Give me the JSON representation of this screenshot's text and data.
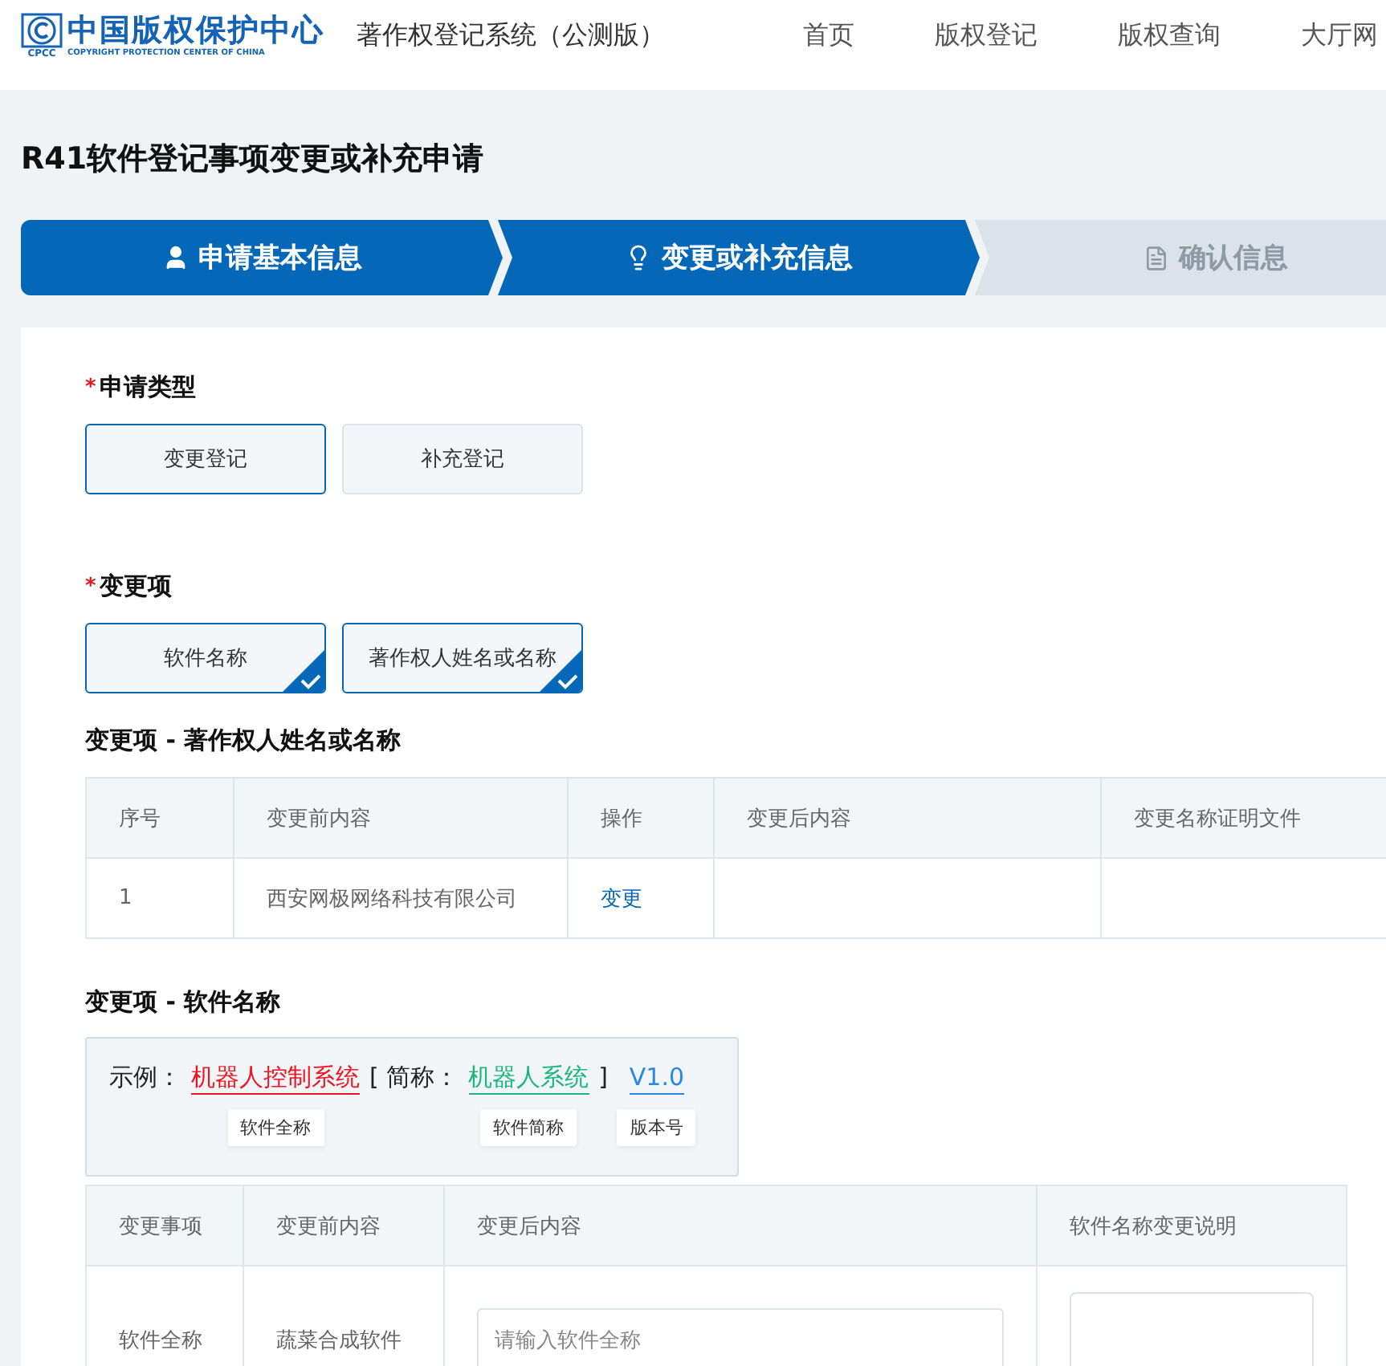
{
  "header": {
    "logo": {
      "name": "中国版权保护中心",
      "abbr": "CPCC",
      "english": "COPYRIGHT PROTECTION CENTER OF CHINA"
    },
    "system_name": "著作权登记系统（公测版）",
    "nav": [
      {
        "label": "首页"
      },
      {
        "label": "版权登记"
      },
      {
        "label": "版权查询"
      },
      {
        "label": "大厅网"
      }
    ]
  },
  "page_title": "R41软件登记事项变更或补充申请",
  "steps": [
    {
      "label": "申请基本信息",
      "kind": "person",
      "reached": true
    },
    {
      "label": "变更或补充信息",
      "kind": "bulb",
      "reached": true
    },
    {
      "label": "确认信息",
      "kind": "document",
      "reached": false
    }
  ],
  "application_type": {
    "required_mark": "*",
    "label": "申请类型",
    "options": [
      {
        "label": "变更登记",
        "selected": true
      },
      {
        "label": "补充登记",
        "selected": false
      }
    ]
  },
  "change_items": {
    "required_mark": "*",
    "label": "变更项",
    "options": [
      {
        "label": "软件名称",
        "checked": true
      },
      {
        "label": "著作权人姓名或名称",
        "checked": true
      }
    ]
  },
  "owner_section": {
    "title": "变更项 - 著作权人姓名或名称",
    "columns": [
      "序号",
      "变更前内容",
      "操作",
      "变更后内容",
      "变更名称证明文件"
    ],
    "rows": [
      {
        "index": "1",
        "before": "西安网极网络科技有限公司",
        "action": "变更"
      }
    ]
  },
  "name_section": {
    "title": "变更项 - 软件名称",
    "example": [
      {
        "kind": "plain",
        "text": "示例："
      },
      {
        "kind": "term",
        "text": "机器人控制系统",
        "color": "#f0141e",
        "tag": "软件全称"
      },
      {
        "kind": "plain",
        "text": "[ 简称："
      },
      {
        "kind": "term",
        "text": "机器人系统",
        "color": "#19b77a",
        "tag": "软件简称"
      },
      {
        "kind": "plain",
        "text": "]"
      },
      {
        "kind": "term",
        "text": "V1.0",
        "color": "#2b88e0",
        "tag": "版本号"
      }
    ],
    "columns": [
      "变更事项",
      "变更前内容",
      "变更后内容",
      "软件名称变更说明"
    ],
    "rows": [
      {
        "item": "软件全称",
        "before": "蔬菜合成软件",
        "placeholder": "请输入软件全称"
      }
    ]
  }
}
